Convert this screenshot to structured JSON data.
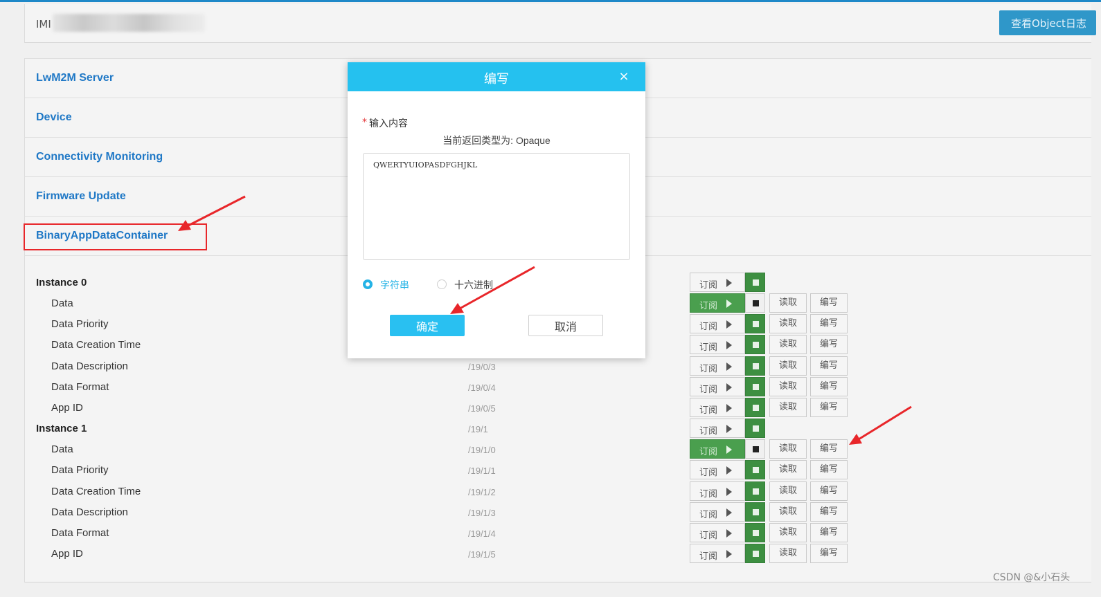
{
  "header": {
    "imei_label": "IMI",
    "log_button": "查看Object日志"
  },
  "sections": [
    {
      "title": "LwM2M Server"
    },
    {
      "title": "Device"
    },
    {
      "title": "Connectivity Monitoring"
    },
    {
      "title": "Firmware Update"
    },
    {
      "title": "BinaryAppDataContainer"
    }
  ],
  "buttons": {
    "subscribe": "订阅",
    "read": "读取",
    "write": "编写"
  },
  "rows": [
    {
      "name": "Instance 0",
      "path": "",
      "type": "instance",
      "subscribed": false
    },
    {
      "name": "Data",
      "path": "",
      "type": "resource",
      "subscribed": true
    },
    {
      "name": "Data Priority",
      "path": "",
      "type": "resource",
      "subscribed": false
    },
    {
      "name": "Data Creation Time",
      "path": "",
      "type": "resource",
      "subscribed": false
    },
    {
      "name": "Data Description",
      "path": "/19/0/3",
      "type": "resource",
      "subscribed": false
    },
    {
      "name": "Data Format",
      "path": "/19/0/4",
      "type": "resource",
      "subscribed": false
    },
    {
      "name": "App ID",
      "path": "/19/0/5",
      "type": "resource",
      "subscribed": false
    },
    {
      "name": "Instance 1",
      "path": "/19/1",
      "type": "instance",
      "subscribed": false
    },
    {
      "name": "Data",
      "path": "/19/1/0",
      "type": "resource",
      "subscribed": true
    },
    {
      "name": "Data Priority",
      "path": "/19/1/1",
      "type": "resource",
      "subscribed": false
    },
    {
      "name": "Data Creation Time",
      "path": "/19/1/2",
      "type": "resource",
      "subscribed": false
    },
    {
      "name": "Data Description",
      "path": "/19/1/3",
      "type": "resource",
      "subscribed": false
    },
    {
      "name": "Data Format",
      "path": "/19/1/4",
      "type": "resource",
      "subscribed": false
    },
    {
      "name": "App ID",
      "path": "/19/1/5",
      "type": "resource",
      "subscribed": false
    }
  ],
  "dialog": {
    "title": "编写",
    "close_icon": "×",
    "required_mark": "*",
    "field_label": "输入内容",
    "type_hint": "当前返回类型为: Opaque",
    "content_value": "QWERTYUIOPASDFGHJKL",
    "radio_string": "字符串",
    "radio_hex": "十六进制",
    "selected_format": "字符串",
    "ok_label": "确定",
    "cancel_label": "取消"
  },
  "watermark": "CSDN @&小石头",
  "colors": {
    "accent": "#25c1ef",
    "section_title": "#1f78c6",
    "subscribed_green": "#4a9f4e",
    "annotation_red": "#e8262a"
  }
}
